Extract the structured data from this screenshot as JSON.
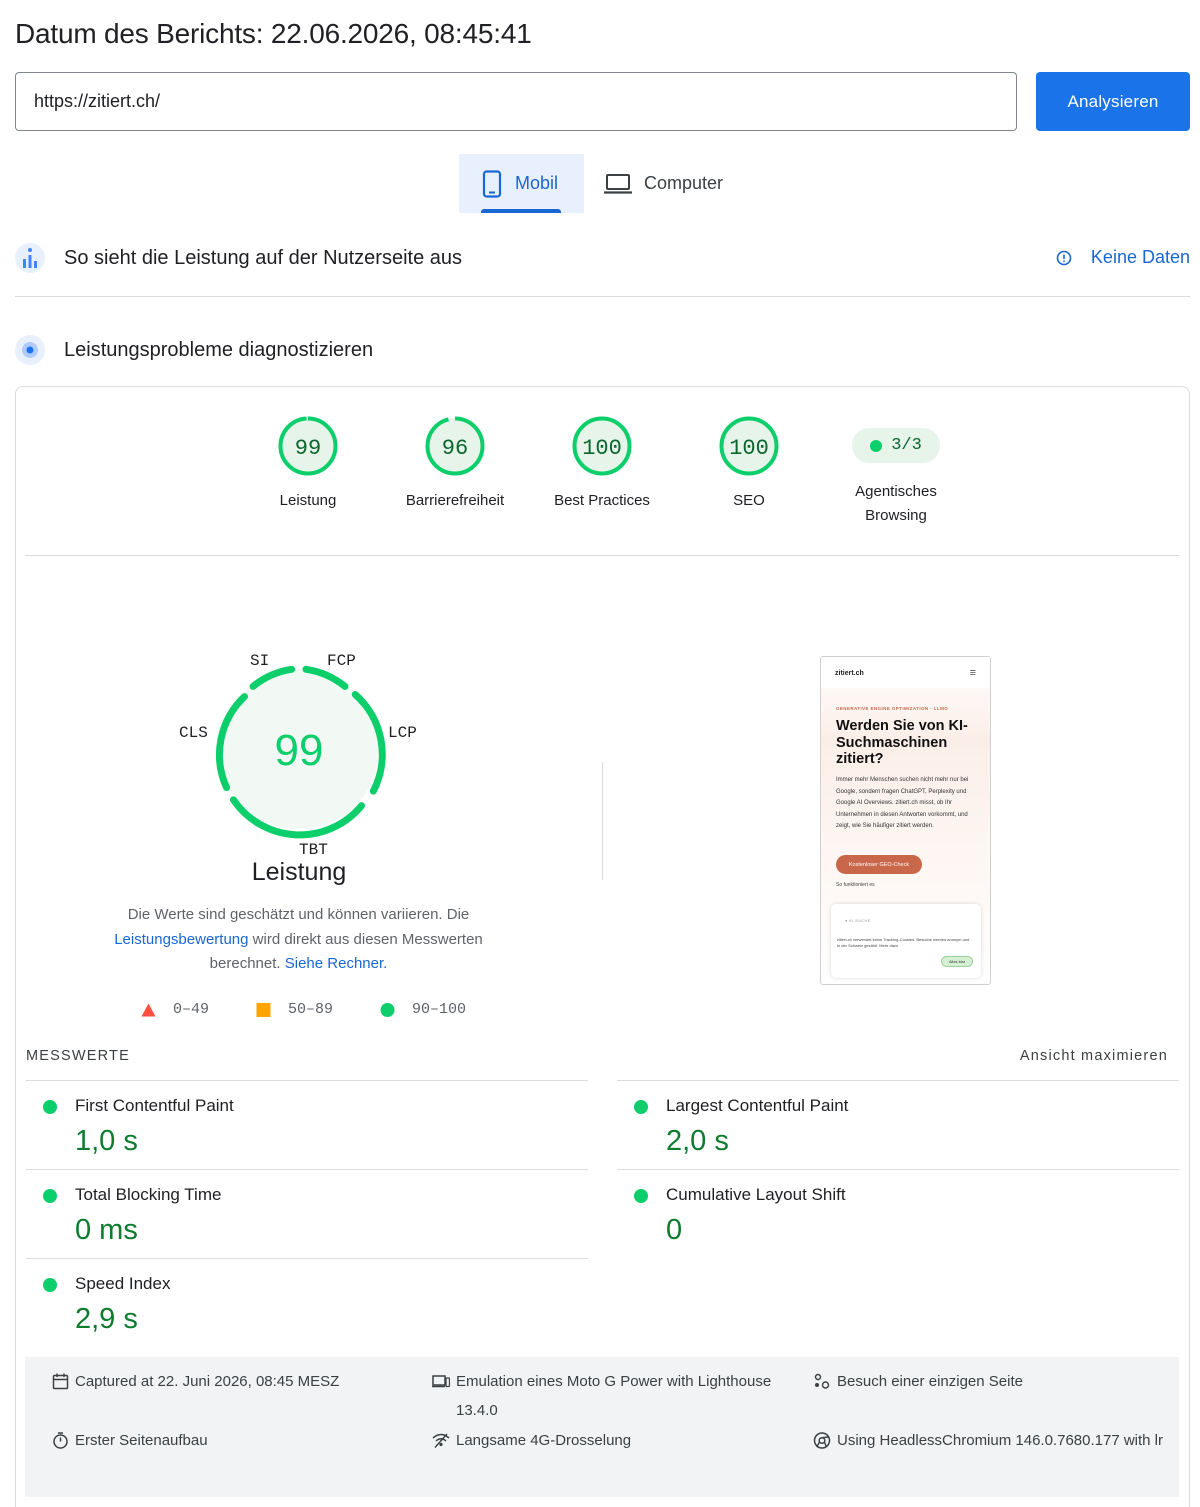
{
  "header": {
    "title": "Datum des Berichts: 22.06.2026, 08:45:41",
    "url_value": "https://zitiert.ch/",
    "analyze_label": "Analysieren"
  },
  "device_tabs": [
    {
      "label": "Mobil",
      "icon": "smartphone-icon",
      "selected": true
    },
    {
      "label": "Computer",
      "icon": "laptop-icon",
      "selected": false
    }
  ],
  "field_data": {
    "title": "So sieht die Leistung auf der Nutzerseite aus",
    "no_data_label": "Keine Daten"
  },
  "lab": {
    "title": "Leistungsprobleme diagnostizieren",
    "categories": [
      {
        "score": "99",
        "label": "Leistung",
        "fraction": 0.99
      },
      {
        "score": "96",
        "label": "Barrierefreiheit",
        "fraction": 0.96
      },
      {
        "score": "100",
        "label": "Best Practices",
        "fraction": 1.0
      },
      {
        "score": "100",
        "label": "SEO",
        "fraction": 1.0
      }
    ],
    "agentic": {
      "value": "3/3",
      "label": "Agentisches Browsing"
    }
  },
  "performance": {
    "score": "99",
    "label": "Leistung",
    "metric_tags": {
      "si": "SI",
      "fcp": "FCP",
      "lcp": "LCP",
      "tbt": "TBT",
      "cls": "CLS"
    },
    "description_1": "Die Werte sind geschätzt und können variieren. Die",
    "description_link1": "Leistungsbewertung",
    "description_2": "wird direkt aus diesen Messwerten berechnet.",
    "description_link2": "Siehe Rechner.",
    "legend": [
      {
        "range": "0–49",
        "color": "#ff4e42"
      },
      {
        "range": "50–89",
        "color": "#ffa400"
      },
      {
        "range": "90–100",
        "color": "#0cce6b"
      }
    ]
  },
  "screenshot": {
    "logo": "zitiert.ch",
    "kicker": "GENERATIVE ENGINE OPTIMIZATION · LLMO",
    "headline": "Werden Sie von KI-Suchmaschinen zitiert?",
    "body": "Immer mehr Menschen suchen nicht mehr nur bei Google, sondern fragen ChatGPT, Perplexity und Google AI Overviews. zitiert.ch misst, ob Ihr Unternehmen in diesen Antworten vorkommt, und zeigt, wie Sie häufiger zitiert werden.",
    "cta": "Kostenloser GEO-Check",
    "how": "So funktioniert es",
    "card_kicker": "● KI-SUCHE",
    "cookie_text": "zitiert.ch verwendet keine Tracking-Cookies. Besuche werden anonym und in der Schweiz gezählt. Mehr dazu",
    "cookie_ok": "Alles klar"
  },
  "metrics": {
    "section_label": "MESSWERTE",
    "expand_label": "Ansicht maximieren",
    "items": [
      {
        "name": "First Contentful Paint",
        "value": "1,0 s"
      },
      {
        "name": "Largest Contentful Paint",
        "value": "2,0 s"
      },
      {
        "name": "Total Blocking Time",
        "value": "0 ms"
      },
      {
        "name": "Cumulative Layout Shift",
        "value": "0"
      },
      {
        "name": "Speed Index",
        "value": "2,9 s"
      }
    ]
  },
  "run_info": {
    "captured": "Captured at 22. Juni 2026, 08:45 MESZ",
    "emulation": "Emulation eines Moto G Power with Lighthouse 13.4.0",
    "visit": "Besuch einer einzigen Seite",
    "load": "Erster Seitenaufbau",
    "throttling": "Langsame 4G-Drosselung",
    "browser": "Using HeadlessChromium 146.0.7680.177 with lr"
  },
  "colors": {
    "accent": "#1a73e8",
    "pass": "#0cce6b",
    "pass_text": "#0d7c2d",
    "pass_bg": "#e6f4ea"
  }
}
